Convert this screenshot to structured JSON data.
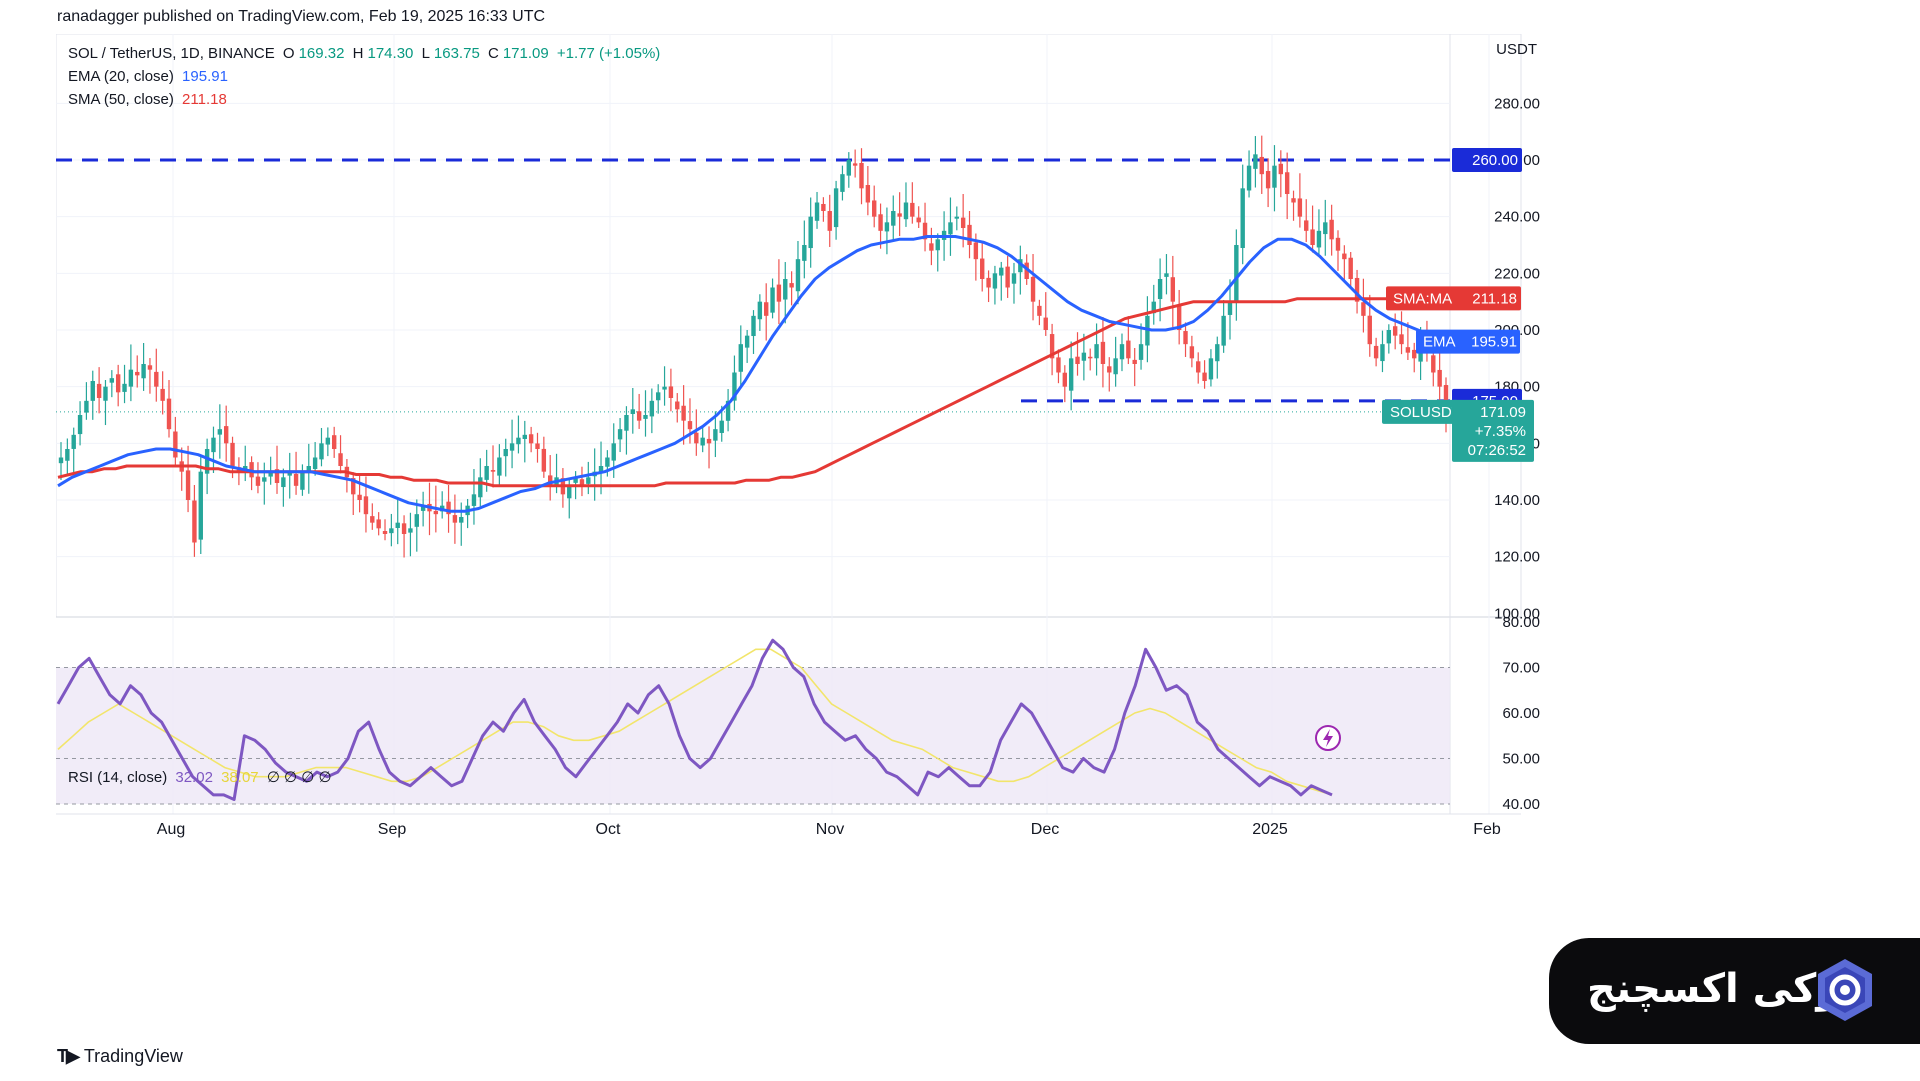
{
  "header": {
    "published": "ranadagger published on TradingView.com, Feb 19, 2025 16:33 UTC"
  },
  "legend": {
    "symbol": "SOL / TetherUS, 1D, BINANCE",
    "o_label": "O",
    "o_val": "169.32",
    "h_label": "H",
    "h_val": "174.30",
    "l_label": "L",
    "l_val": "163.75",
    "c_label": "C",
    "c_val": "171.09",
    "change": "+1.77 (+1.05%)",
    "ema_label": "EMA (20, close)",
    "ema_val": "195.91",
    "sma_label": "SMA (50, close)",
    "sma_val": "211.18",
    "rsi_label": "RSI (14, close)",
    "rsi_val": "32.02",
    "rsi_ma_val": "38.07",
    "rsi_extra": "∅ ∅ ∅ ∅"
  },
  "colors": {
    "up": "#26a69a",
    "down": "#ef5350",
    "ema": "#2962ff",
    "sma": "#e53935",
    "dashed": "#1a2bd8",
    "rsi": "#7e57c2",
    "rsi_ma": "#f2e56b",
    "rsi_band": "#ede7f6"
  },
  "price_axis": {
    "unit": "USDT",
    "ticks": [
      "280.00",
      "260.00",
      "240.00",
      "220.00",
      "200.00",
      "180.00",
      "160.00",
      "140.00",
      "120.00",
      "100.00"
    ]
  },
  "rsi_axis": {
    "ticks": [
      "80.00",
      "70.00",
      "60.00",
      "50.00",
      "40.00"
    ]
  },
  "badges": {
    "level_260": "260.00",
    "sma": {
      "label": "SMA:MA",
      "value": "211.18"
    },
    "ema": {
      "label": "EMA",
      "value": "195.91"
    },
    "level_175": "175.00",
    "last": {
      "symbol": "SOLUSDT",
      "price": "171.09",
      "change": "+7.35%",
      "countdown": "07:26:52"
    }
  },
  "time_axis": [
    "Aug",
    "Sep",
    "Oct",
    "Nov",
    "Dec",
    "2025",
    "Feb"
  ],
  "brand": {
    "tradingview": "TradingView",
    "okx_text": "اوکی اکسچنج"
  },
  "chart_data": [
    {
      "type": "candlestick",
      "title": "SOL / TetherUS, 1D, BINANCE",
      "x_range": [
        "2024-07-19",
        "2025-02-19"
      ],
      "ylim": [
        100,
        300
      ],
      "horizontal_levels": [
        260,
        175
      ],
      "close": [
        155,
        158,
        163,
        170,
        175,
        182,
        176,
        180,
        183,
        178,
        181,
        186,
        184,
        188,
        186,
        180,
        175,
        165,
        155,
        150,
        140,
        125,
        150,
        158,
        162,
        165,
        160,
        152,
        150,
        152,
        148,
        145,
        148,
        150,
        146,
        148,
        150,
        145,
        150,
        152,
        155,
        160,
        162,
        158,
        152,
        148,
        142,
        140,
        135,
        132,
        130,
        128,
        130,
        132,
        128,
        130,
        135,
        138,
        136,
        135,
        138,
        135,
        132,
        134,
        138,
        142,
        148,
        152,
        150,
        155,
        158,
        160,
        162,
        163,
        160,
        158,
        150,
        145,
        148,
        142,
        145,
        148,
        145,
        148,
        150,
        152,
        155,
        160,
        165,
        170,
        172,
        168,
        170,
        175,
        178,
        180,
        176,
        172,
        168,
        165,
        160,
        162,
        160,
        165,
        168,
        175,
        185,
        195,
        198,
        205,
        210,
        205,
        215,
        210,
        218,
        215,
        225,
        230,
        240,
        245,
        242,
        235,
        250,
        255,
        260,
        258,
        250,
        245,
        240,
        235,
        238,
        242,
        240,
        245,
        240,
        238,
        232,
        228,
        232,
        235,
        238,
        240,
        236,
        230,
        225,
        218,
        215,
        220,
        222,
        215,
        220,
        225,
        218,
        210,
        205,
        200,
        190,
        185,
        180,
        190,
        188,
        192,
        190,
        195,
        188,
        185,
        190,
        195,
        190,
        188,
        195,
        205,
        210,
        218,
        220,
        210,
        200,
        195,
        190,
        185,
        182,
        190,
        195,
        205,
        210,
        230,
        250,
        258,
        262,
        255,
        250,
        258,
        255,
        248,
        245,
        240,
        235,
        230,
        235,
        238,
        232,
        228,
        225,
        218,
        210,
        205,
        195,
        190,
        195,
        200,
        198,
        195,
        192,
        190,
        195,
        192,
        185,
        180,
        171
      ],
      "sma50": [
        148,
        149,
        150,
        150,
        151,
        151,
        152,
        152,
        152,
        152,
        152,
        152,
        152,
        151,
        151,
        150,
        150,
        150,
        150,
        150,
        150,
        150,
        150,
        150,
        150,
        150,
        149,
        149,
        149,
        148,
        148,
        147,
        147,
        147,
        146,
        146,
        146,
        146,
        145,
        145,
        145,
        145,
        145,
        145,
        145,
        145,
        145,
        145,
        145,
        145,
        145,
        145,
        145,
        146,
        146,
        146,
        146,
        146,
        146,
        146,
        147,
        147,
        147,
        148,
        148,
        149,
        150,
        152,
        154,
        156,
        158,
        160,
        162,
        164,
        166,
        168,
        170,
        172,
        174,
        176,
        178,
        180,
        182,
        184,
        186,
        188,
        190,
        192,
        194,
        196,
        198,
        200,
        202,
        204,
        205,
        206,
        207,
        208,
        209,
        210,
        210,
        210,
        210,
        210,
        210,
        210,
        210,
        210,
        211,
        211,
        211,
        211,
        211,
        211,
        211,
        211,
        211,
        211,
        211,
        211,
        211,
        211
      ],
      "ema20": [
        145,
        148,
        150,
        152,
        154,
        156,
        157,
        158,
        158,
        157,
        156,
        154,
        152,
        151,
        150,
        150,
        150,
        150,
        150,
        149,
        148,
        147,
        145,
        143,
        141,
        139,
        138,
        137,
        136,
        136,
        137,
        139,
        141,
        143,
        144,
        146,
        147,
        148,
        149,
        150,
        152,
        154,
        156,
        158,
        160,
        163,
        166,
        170,
        175,
        182,
        190,
        198,
        205,
        212,
        218,
        222,
        225,
        228,
        230,
        231,
        232,
        232,
        233,
        233,
        233,
        232,
        231,
        229,
        226,
        222,
        218,
        214,
        210,
        207,
        205,
        203,
        202,
        201,
        200,
        200,
        201,
        203,
        207,
        212,
        218,
        224,
        229,
        232,
        232,
        230,
        226,
        221,
        216,
        211,
        207,
        204,
        202,
        200,
        198,
        196
      ],
      "series": [
        {
          "name": "EMA (20, close)",
          "last": 195.91
        },
        {
          "name": "SMA (50, close)",
          "last": 211.18
        }
      ]
    },
    {
      "type": "line",
      "title": "RSI (14, close)",
      "ylim": [
        40,
        80
      ],
      "bands": [
        70,
        50
      ],
      "rsi": [
        62,
        66,
        70,
        72,
        68,
        64,
        62,
        66,
        64,
        60,
        58,
        54,
        50,
        46,
        44,
        42,
        42,
        41,
        55,
        54,
        52,
        49,
        47,
        46,
        45,
        47,
        46,
        47,
        50,
        56,
        58,
        52,
        47,
        45,
        44,
        46,
        48,
        46,
        44,
        45,
        50,
        55,
        58,
        56,
        60,
        63,
        58,
        55,
        52,
        48,
        46,
        49,
        52,
        55,
        58,
        62,
        60,
        64,
        66,
        62,
        55,
        50,
        48,
        50,
        54,
        58,
        62,
        66,
        72,
        76,
        74,
        70,
        68,
        62,
        58,
        56,
        54,
        55,
        52,
        50,
        47,
        46,
        44,
        42,
        47,
        46,
        48,
        46,
        44,
        44,
        47,
        54,
        58,
        62,
        60,
        56,
        52,
        48,
        47,
        50,
        48,
        47,
        52,
        60,
        66,
        74,
        70,
        65,
        66,
        64,
        58,
        56,
        52,
        50,
        48,
        46,
        44,
        46,
        45,
        44,
        42,
        44,
        43,
        42
      ],
      "rsi_ma": [
        52,
        55,
        58,
        60,
        62,
        60,
        58,
        56,
        54,
        52,
        50,
        48,
        47,
        46,
        46,
        46,
        47,
        48,
        48,
        48,
        47,
        46,
        45,
        45,
        46,
        48,
        50,
        52,
        54,
        56,
        58,
        58,
        57,
        55,
        54,
        54,
        55,
        56,
        58,
        60,
        62,
        64,
        66,
        68,
        70,
        72,
        74,
        74,
        72,
        70,
        66,
        62,
        60,
        58,
        56,
        54,
        53,
        52,
        50,
        48,
        47,
        46,
        45,
        45,
        46,
        48,
        50,
        52,
        54,
        56,
        58,
        60,
        61,
        60,
        58,
        56,
        54,
        52,
        50,
        48,
        47,
        45,
        44,
        43,
        42
      ]
    }
  ]
}
